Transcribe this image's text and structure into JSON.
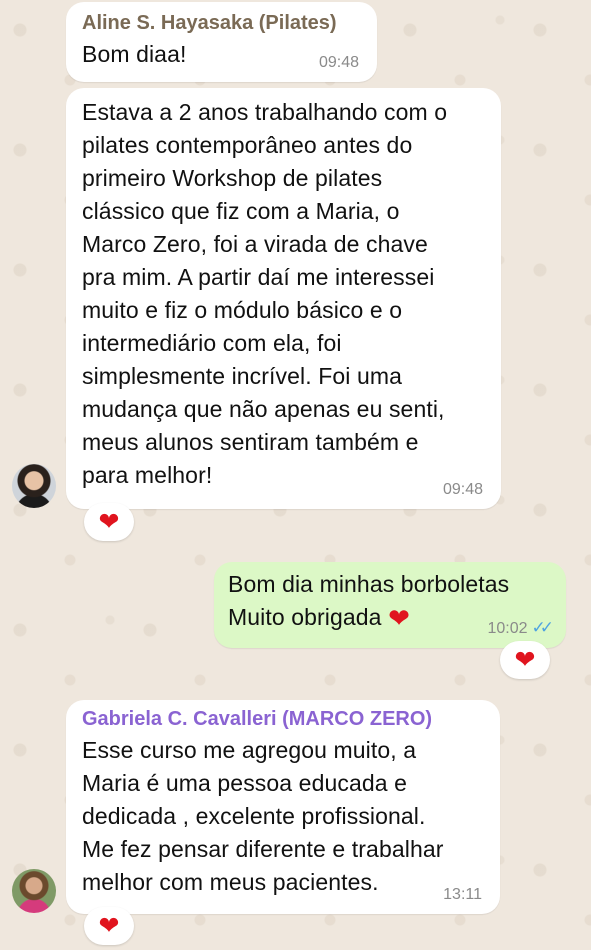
{
  "messages": [
    {
      "sender": "Aline S. Hayasaka (Pilates)",
      "sender_color": "#7a6a55",
      "text": "Bom diaa!",
      "time": "09:48"
    },
    {
      "text": "Estava a 2 anos trabalhando com o\npilates contemporâneo antes do\nprimeiro Workshop de pilates\nclássico que fiz com a Maria, o\nMarco Zero, foi a virada de chave\npra mim. A partir daí me interessei\nmuito e fiz o módulo básico e o\nintermediário com ela, foi\nsimplesmente incrível. Foi uma\nmudança que não apenas eu senti,\nmeus alunos sentiram também e\npara melhor!",
      "time": "09:48",
      "reaction": "❤"
    },
    {
      "text": "Bom dia minhas borboletas\nMuito obrigada",
      "inline_emoji": "❤",
      "time": "10:02",
      "ticks": "✓✓",
      "reaction": "❤"
    },
    {
      "sender": "Gabriela C. Cavalleri (MARCO ZERO)",
      "sender_color": "#8a63d2",
      "text": "Esse curso me agregou muito, a\nMaria é uma pessoa educada e\ndedicada , excelente profissional.\nMe fez pensar diferente e trabalhar\nmelhor com meus pacientes.",
      "time": "13:11",
      "reaction": "❤"
    }
  ],
  "colors": {
    "background": "#efe7dd",
    "incoming_bubble": "#ffffff",
    "outgoing_bubble": "#dcf8c6",
    "read_ticks": "#4fa3e0",
    "heart": "#e0141e"
  }
}
